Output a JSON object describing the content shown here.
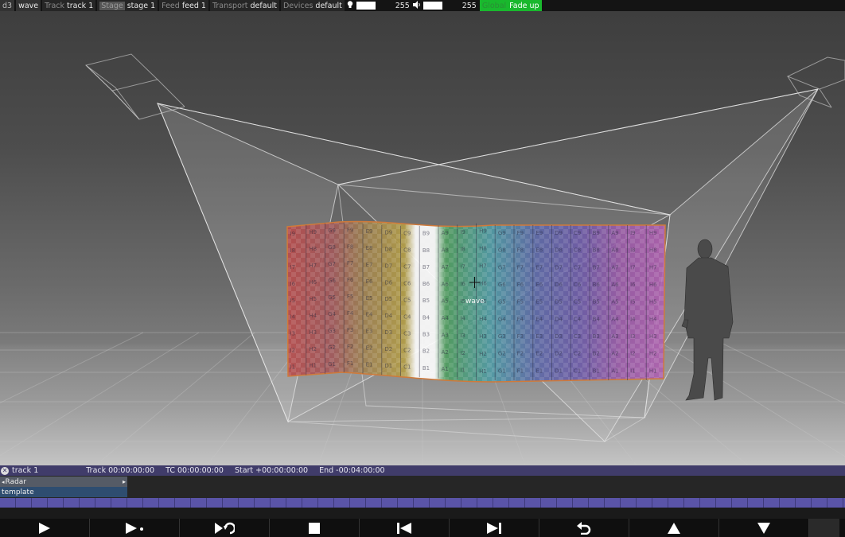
{
  "topbar": {
    "app": "d3",
    "project": "wave",
    "track_key": "Track",
    "track_val": "track 1",
    "stage_key": "Stage",
    "stage_val": "stage 1",
    "feed_key": "Feed",
    "feed_val": "feed 1",
    "transport_key": "Transport",
    "transport_val": "default",
    "devices_key": "Devices",
    "devices_val": "default",
    "brightness_icon": "lightbulb-icon",
    "brightness_value": "255",
    "volume_icon": "speaker-icon",
    "volume_value": "255",
    "fade_key": "Global",
    "fade_label": "Fade up",
    "fade_color": "#19b82d"
  },
  "viewport": {
    "screen_label": "wave",
    "columns": [
      "I",
      "H",
      "G",
      "F",
      "E",
      "D",
      "C",
      "B",
      "A"
    ],
    "rows": [
      "9",
      "8",
      "7",
      "6",
      "5",
      "4",
      "3",
      "2",
      "1"
    ]
  },
  "timeline": {
    "close_icon": "close-icon",
    "track_name": "track 1",
    "track_time": "Track 00:00:00:00",
    "tc_time": "TC 00:00:00:00",
    "start_time": "Start +00:00:00:00",
    "end_time": "End -00:04:00:00",
    "layers": [
      {
        "label": "Radar",
        "icon": "caret-icon"
      },
      {
        "label": "template"
      }
    ],
    "track_color": "#5a54a8",
    "header_color": "#403c6a"
  },
  "transport": [
    {
      "icon": "play-icon",
      "glyph": "▶"
    },
    {
      "icon": "play-to-end-icon",
      "glyph": "▶•"
    },
    {
      "icon": "loop-icon",
      "glyph": "⟳"
    },
    {
      "icon": "stop-icon",
      "glyph": "■"
    },
    {
      "icon": "previous-icon",
      "glyph": "|◀"
    },
    {
      "icon": "next-icon",
      "glyph": "▶|"
    },
    {
      "icon": "return-icon",
      "glyph": "↶"
    },
    {
      "icon": "up-icon",
      "glyph": "▲"
    },
    {
      "icon": "down-icon",
      "glyph": "▼"
    }
  ]
}
